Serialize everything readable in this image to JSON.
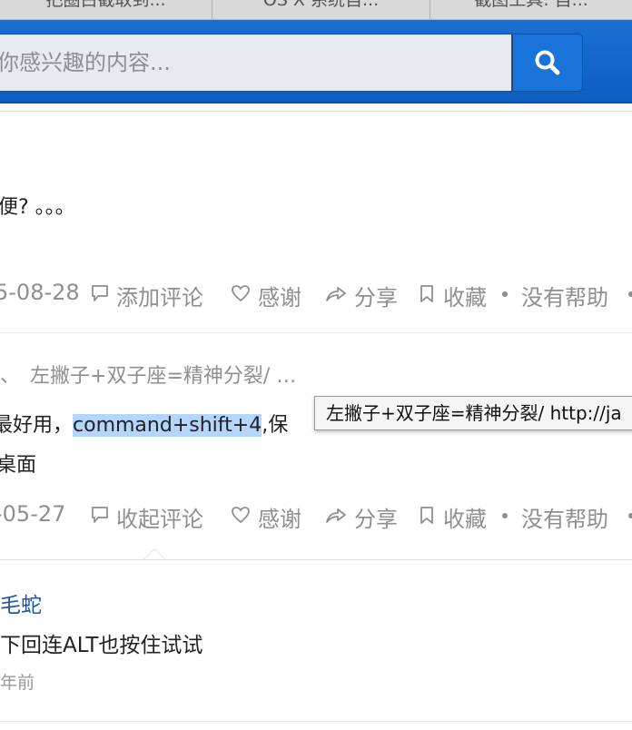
{
  "tabs": [
    {
      "label": "把圈白截取到..."
    },
    {
      "label": "OS X 系统自..."
    },
    {
      "label": "截图工具: 自..."
    }
  ],
  "search": {
    "placeholder": "你感兴趣的内容..."
  },
  "answer1": {
    "text": "便? 。。。",
    "date": "5-08-28",
    "comment_label": "添加评论",
    "thanks_label": "感谢",
    "share_label": "分享",
    "collect_label": "收藏",
    "unhelpful_label": "没有帮助"
  },
  "answer2": {
    "author_prefix": "、",
    "author_bio": "左撇子+双子座=精神分裂/ …",
    "text_before": "最好用，",
    "text_highlight": "command+shift+4",
    "text_after": ",保",
    "text_line2": "桌面",
    "date": "-05-27",
    "comment_label": "收起评论",
    "thanks_label": "感谢",
    "share_label": "分享",
    "collect_label": "收藏",
    "unhelpful_label": "没有帮助"
  },
  "tooltip": {
    "text": "左撇子+双子座=精神分裂/ http://ja"
  },
  "comment": {
    "author": "毛蛇",
    "text": "下回连ALT也按住试试",
    "time": "年前"
  },
  "colors": {
    "header_blue": "#0e5ec1",
    "link_blue": "#225599",
    "highlight": "#b4d5fe",
    "meta_gray": "#8f8f8f"
  }
}
